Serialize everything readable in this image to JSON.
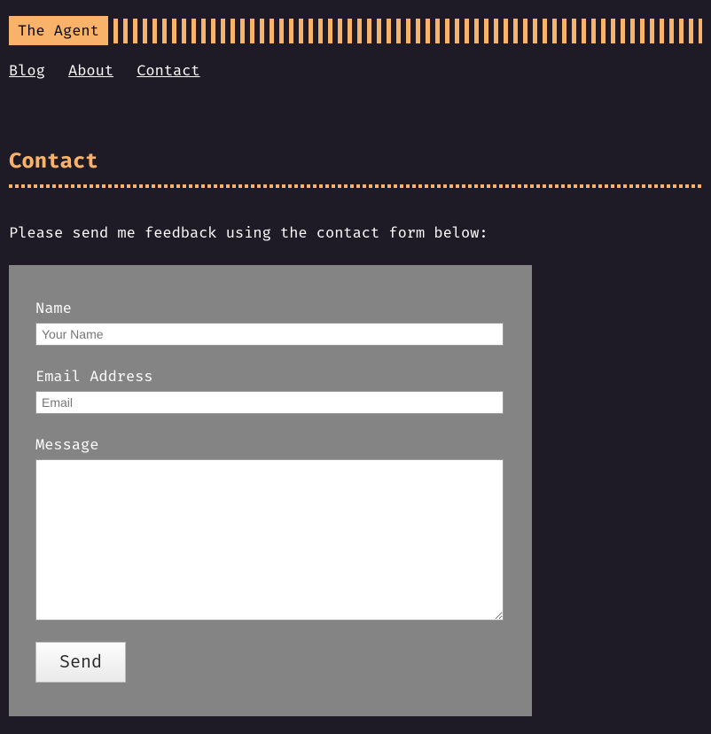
{
  "header": {
    "logo": "The Agent"
  },
  "nav": {
    "items": [
      "Blog",
      "About",
      "Contact"
    ]
  },
  "page": {
    "title": "Contact",
    "intro": "Please send me feedback using the contact form below:"
  },
  "form": {
    "name_label": "Name",
    "name_placeholder": "Your Name",
    "email_label": "Email Address",
    "email_placeholder": "Email",
    "message_label": "Message",
    "send_label": "Send"
  }
}
